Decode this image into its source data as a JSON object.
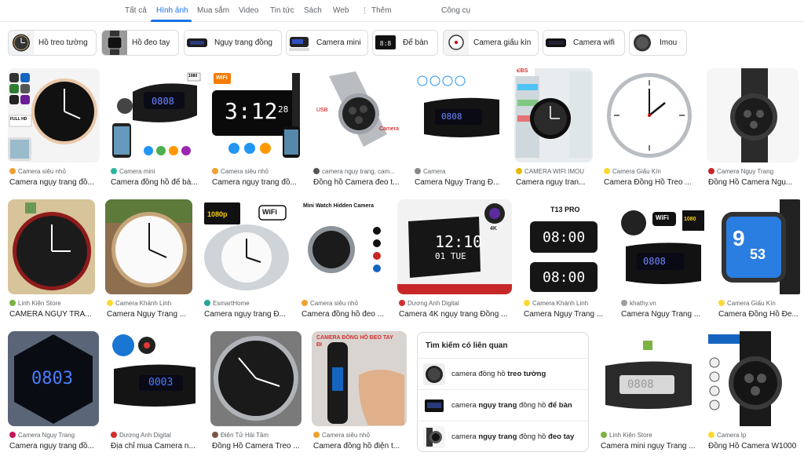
{
  "tabs": [
    {
      "label": "Tất cả"
    },
    {
      "label": "Hình ảnh",
      "active": true
    },
    {
      "label": "Mua sắm"
    },
    {
      "label": "Video"
    },
    {
      "label": "Tin tức"
    },
    {
      "label": "Sách"
    },
    {
      "label": "Web"
    },
    {
      "label": "Thêm",
      "icon": "more-vert-icon"
    },
    {
      "label": "Công cụ"
    }
  ],
  "chips": [
    {
      "label": "Hồ treo tường"
    },
    {
      "label": "Hồ đeo tay"
    },
    {
      "label": "Ngụy trang đồng"
    },
    {
      "label": "Camera mini"
    },
    {
      "label": "Để bàn"
    },
    {
      "label": "Camera giấu kín"
    },
    {
      "label": "Camera wifi"
    },
    {
      "label": "Imou"
    }
  ],
  "results": [
    {
      "source": "Camera siêu nhỏ",
      "title": "Camera ngụy trang đồ..."
    },
    {
      "source": "Camera mini",
      "title": "Camera đồng hồ để bà..."
    },
    {
      "source": "Camera siêu nhỏ",
      "title": "Camera ngụy trang đồ..."
    },
    {
      "source": "camera ngụy trang, cam...",
      "title": "Đồng hồ Camera đeo t..."
    },
    {
      "source": "Camera",
      "title": "Camera Ngụy Trang Đ..."
    },
    {
      "source": "CAMERA WIFI IMOU",
      "title": "Camera ngụy tran..."
    },
    {
      "source": "Camera Giấu Kín",
      "title": "Camera Đồng Hồ Treo ..."
    },
    {
      "source": "Camera Ngụy Trang",
      "title": "Đồng Hồ Camera Ngụ..."
    },
    {
      "source": "Linh Kiện Store",
      "title": "CAMERA NGỤY TRA..."
    },
    {
      "source": "Camera Khánh Linh",
      "title": "Camera Ngụy Trang ..."
    },
    {
      "source": "EsmartHome",
      "title": "Camera ngụy trang Đ..."
    },
    {
      "source": "Camera siêu nhỏ",
      "title": "Camera đồng hồ đeo ..."
    },
    {
      "source": "Dương Anh Digital",
      "title": "Camera 4K ngụy trang Đồng ..."
    },
    {
      "source": "Camera Khánh Linh",
      "title": "Camera Ngụy Trang ..."
    },
    {
      "source": "khathy.vn",
      "title": "Camera Ngụy Trang ..."
    },
    {
      "source": "Camera Giấu Kín",
      "title": "Camera Đồng Hồ Đe..."
    },
    {
      "source": "Camera Ngụy Trang",
      "title": "Camera ngụy trang đồ..."
    },
    {
      "source": "Dương Anh Digital",
      "title": "Địa chỉ mua Camera n..."
    },
    {
      "source": "Điện Tử Hải Tâm",
      "title": "Đồng Hồ Camera Treo ..."
    },
    {
      "source": "Camera siêu nhỏ",
      "title": "Camera đồng hồ điện t..."
    },
    {
      "source": "Linh Kiện Store",
      "title": "Camera mini ngụy Trang ..."
    },
    {
      "source": "Camera Ip",
      "title": "Đồng Hồ Camera W1000"
    }
  ],
  "image_text": {
    "clock_312": "3:12",
    "clock_312_small": "28",
    "clock_1210": "12:10",
    "clock_1210_sub": "01 TUE",
    "clock_0800": "08:00",
    "clock_0800b": "08:00",
    "clock_0803": "0803",
    "clock_0003": "0003",
    "clock_0808": "0808",
    "clock_0808b": "0808",
    "watch_9": "9",
    "watch_53": "53",
    "badge_fullhd": "FULL HD",
    "badge_1080": "1080",
    "badge_1080p": "1080p",
    "badge_wifi": "WiFi",
    "badge_t13": "T13 PRO",
    "badge_mini_watch": "Mini Watch Hidden Camera",
    "badge_camera_dong_ho": "CAMERA ĐỒNG HỒ ĐEO TAY ĐI",
    "badge_ebs": "EBS",
    "badge_usb": "USB",
    "badge_camera": "Camera",
    "badge_4k": "4K"
  },
  "related": {
    "title": "Tìm kiếm có liên quan",
    "items": [
      {
        "pre": "camera đồng hồ ",
        "bold": "treo tường",
        "post": ""
      },
      {
        "pre": "camera ",
        "bold": "ngụy trang",
        "mid": " đồng hồ ",
        "bold2": "để bàn"
      },
      {
        "pre": "camera ",
        "bold": "ngụy trang",
        "mid": " đồng hồ ",
        "bold2": "đeo tay"
      }
    ]
  }
}
